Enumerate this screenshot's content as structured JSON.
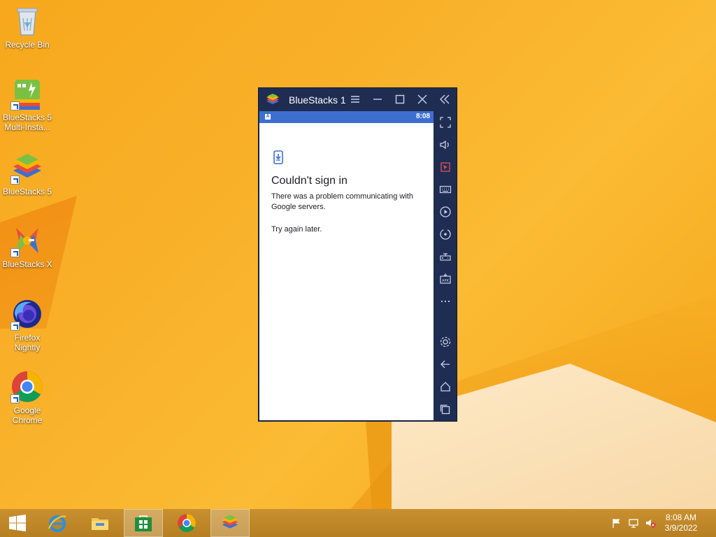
{
  "desktop": {
    "icons": [
      {
        "label": "Recycle Bin"
      },
      {
        "label": "BlueStacks 5 Multi-Insta..."
      },
      {
        "label": "BlueStacks 5"
      },
      {
        "label": "BlueStacks X"
      },
      {
        "label": "Firefox Nightly"
      },
      {
        "label": "Google Chrome"
      }
    ]
  },
  "window": {
    "title": "BlueStacks 1",
    "status_time": "8:08",
    "message": {
      "title": "Couldn't sign in",
      "body": "There was a problem communicating with Google servers.",
      "retry": "Try again later."
    },
    "sidebar_icons": [
      "fullscreen-icon",
      "volume-icon",
      "pointer-icon",
      "keyboard-icon",
      "macro-icon",
      "rotate-icon",
      "gamepad-icon",
      "apk-icon",
      "more-icon",
      "settings-icon",
      "back-icon",
      "home-icon",
      "recents-icon"
    ]
  },
  "taskbar": {
    "items": [
      "start-button",
      "internet-explorer",
      "file-explorer",
      "store",
      "google-chrome",
      "bluestacks"
    ],
    "clock_time": "8:08 AM",
    "clock_date": "3/9/2022"
  },
  "colors": {
    "window_bg": "#1f2d52",
    "status_bar": "#3d6fd1",
    "desktop": "#f9b12a"
  }
}
